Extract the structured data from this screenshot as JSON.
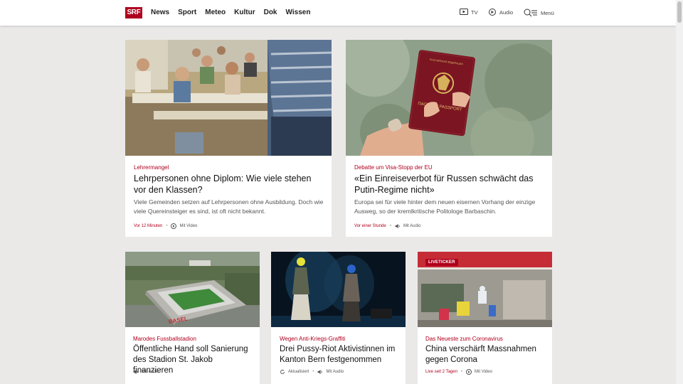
{
  "header": {
    "logo": "SRF",
    "nav": [
      "News",
      "Sport",
      "Meteo",
      "Kultur",
      "Dok",
      "Wissen"
    ],
    "tv_label": "TV",
    "audio_label": "Audio",
    "menu_label": "Menü"
  },
  "articles": [
    {
      "kicker": "Lehrermangel",
      "title": "Lehrpersonen ohne Diplom: Wie viele stehen vor den Klassen?",
      "lead": "Viele Gemeinden setzen auf Lehrpersonen ohne Ausbildung. Doch wie viele Quereinsteiger es sind, ist oft nicht bekannt.",
      "time": "Vor 12 Minuten",
      "media": "Mit Video",
      "media_icon": "play-icon"
    },
    {
      "kicker": "Debatte um Visa-Stopp der EU",
      "title": "«Ein Einreiseverbot für Russen schwächt das Putin-Regime nicht»",
      "lead": "Europa sei für viele hinter dem neuen eisernen Vorhang der einzige Ausweg, so der kremlkritische Politologe Barbaschin.",
      "time": "Vor einer Stunde",
      "media": "Mit Audio",
      "media_icon": "speaker-icon",
      "passport_text": "ПАСПОРТ PASSPORT"
    },
    {
      "kicker": "Marodes Fussballstadion",
      "title": "Öffentliche Hand soll Sanierung des Stadion St. Jakob finanzieren",
      "media": "Mit Audio",
      "media_icon": "speaker-icon",
      "stadium_text": "BASEL"
    },
    {
      "kicker": "Wegen Anti-Kriegs-Graffiti",
      "title": "Drei Pussy-Riot Aktivistinnen im Kanton Bern festgenommen",
      "updated": "Aktualisiert",
      "media": "Mit Audio",
      "media_icon": "speaker-icon"
    },
    {
      "kicker": "Das Neueste zum Coronavirus",
      "title": "China verschärft Massnahmen gegen Corona",
      "badge": "LIVETICKER",
      "time": "Live seit 2 Tagen",
      "media": "Mit Video",
      "media_icon": "play-icon"
    }
  ]
}
